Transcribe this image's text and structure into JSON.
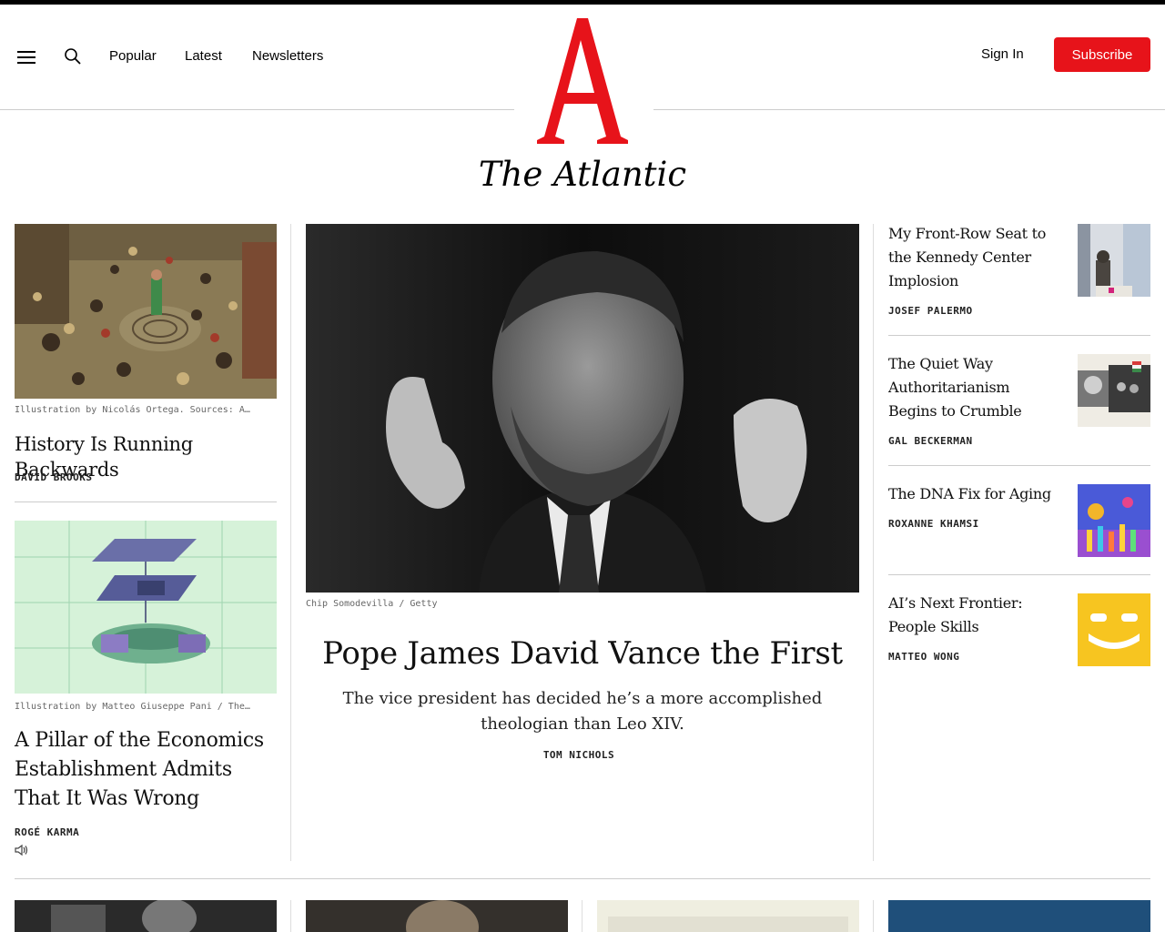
{
  "nav": {
    "menu_icon": "hamburger-icon",
    "search_icon": "search-icon",
    "links": [
      "Popular",
      "Latest",
      "Newsletters"
    ],
    "sign_in": "Sign In",
    "subscribe": "Subscribe"
  },
  "brand": {
    "logo_letter": "A",
    "wordmark": "The Atlantic",
    "logo_color": "#e7131a"
  },
  "left": [
    {
      "caption": "Illustration by Nicolás Ortega. Sources: A…",
      "title": "History Is Running Backwards",
      "author": "DAVID BROOKS"
    },
    {
      "caption": "Illustration by Matteo Giuseppe Pani / The…",
      "title": "A Pillar of the Economics Establishment Admits That It Was Wrong",
      "author": "ROGÉ KARMA",
      "audio_icon": "speaker-icon"
    }
  ],
  "lead": {
    "caption": "Chip Somodevilla / Getty",
    "title": "Pope James David Vance the First",
    "dek": "The vice president has decided he’s a more accomplished theologian than Leo XIV.",
    "author": "TOM NICHOLS"
  },
  "right": [
    {
      "title": "My Front-Row Seat to the Kennedy Center Implosion",
      "author": "JOSEF PALERMO"
    },
    {
      "title": "The Quiet Way Authoritarianism Begins to Crumble",
      "author": "GAL BECKERMAN"
    },
    {
      "title": "The DNA Fix for Aging",
      "author": "ROXANNE KHAMSI"
    },
    {
      "title": "AI’s Next Frontier: People Skills",
      "author": "MATTEO WONG"
    }
  ]
}
